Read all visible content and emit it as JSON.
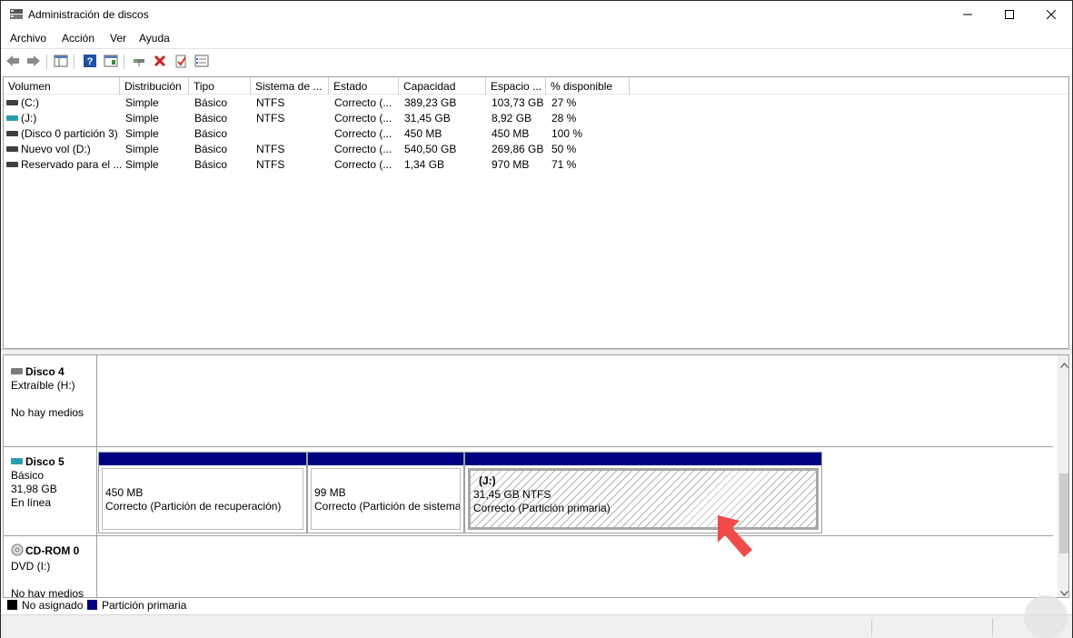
{
  "window": {
    "title": "Administración de discos"
  },
  "menu": [
    "Archivo",
    "Acción",
    "Ver",
    "Ayuda"
  ],
  "toolbar": [
    "back-icon",
    "forward-icon",
    "show-hide-tree-icon",
    "help-icon",
    "properties-icon",
    "connect-icon",
    "delete-icon",
    "check-icon",
    "list-icon"
  ],
  "volumes": {
    "headers": [
      "Volumen",
      "Distribución",
      "Tipo",
      "Sistema de ...",
      "Estado",
      "Capacidad",
      "Espacio ...",
      "% disponible"
    ],
    "rows": [
      {
        "name": "(C:)",
        "layout": "Simple",
        "type": "Básico",
        "fs": "NTFS",
        "status": "Correcto (...",
        "capacity": "389,23 GB",
        "free": "103,73 GB",
        "pct": "27 %",
        "icon_color": "#404040"
      },
      {
        "name": "(J:)",
        "layout": "Simple",
        "type": "Básico",
        "fs": "NTFS",
        "status": "Correcto (...",
        "capacity": "31,45 GB",
        "free": "8,92 GB",
        "pct": "28 %",
        "icon_color": "#2a9fb0"
      },
      {
        "name": "(Disco 0 partición 3)",
        "layout": "Simple",
        "type": "Básico",
        "fs": "",
        "status": "Correcto (...",
        "capacity": "450 MB",
        "free": "450 MB",
        "pct": "100 %",
        "icon_color": "#404040"
      },
      {
        "name": "Nuevo vol (D:)",
        "layout": "Simple",
        "type": "Básico",
        "fs": "NTFS",
        "status": "Correcto (...",
        "capacity": "540,50 GB",
        "free": "269,86 GB",
        "pct": "50 %",
        "icon_color": "#404040"
      },
      {
        "name": "Reservado para el ...",
        "layout": "Simple",
        "type": "Básico",
        "fs": "NTFS",
        "status": "Correcto (...",
        "capacity": "1,34 GB",
        "free": "970 MB",
        "pct": "71 %",
        "icon_color": "#404040"
      }
    ]
  },
  "disks": {
    "disk4": {
      "name": "Disco 4",
      "line1": "Extraíble (H:)",
      "line2": "No hay medios"
    },
    "disk5": {
      "name": "Disco 5",
      "line1": "Básico",
      "line2": "31,98 GB",
      "line3": "En línea",
      "partitions": [
        {
          "title": "",
          "size": "450 MB",
          "status": "Correcto (Partición de recuperación)"
        },
        {
          "title": "",
          "size": "99 MB",
          "status": "Correcto (Partición de sistema"
        },
        {
          "title": "(J:)",
          "size": "31,45 GB NTFS",
          "status": "Correcto (Partición primaria)"
        }
      ]
    },
    "cdrom": {
      "name": "CD-ROM 0",
      "line1": "DVD (I:)",
      "line2": "No hay medios"
    }
  },
  "legend": [
    {
      "label": "No asignado",
      "color": "#000000"
    },
    {
      "label": "Partición primaria",
      "color": "#000080"
    }
  ],
  "colors": {
    "partition_bar": "#000080",
    "annotation_arrow": "#ef4b4b"
  }
}
